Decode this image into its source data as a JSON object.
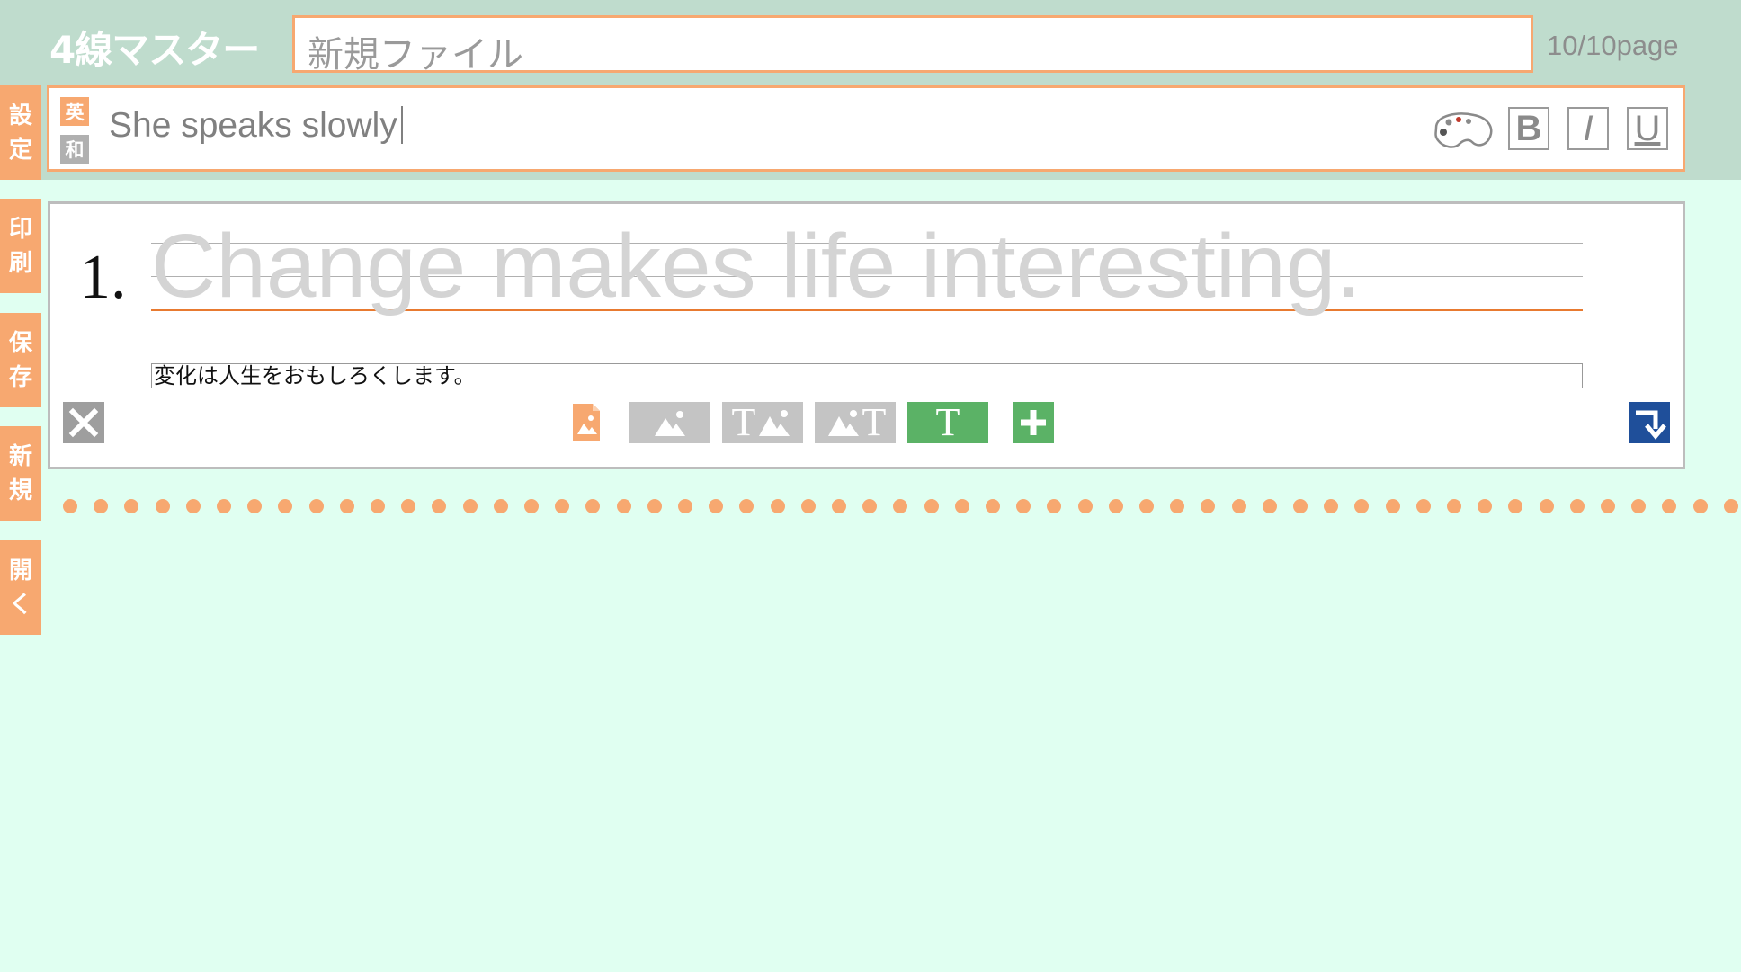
{
  "app": {
    "title": "4線マスター",
    "page_count": "10/10page"
  },
  "file": {
    "name": "新規ファイル"
  },
  "sidebar": {
    "items": [
      {
        "chars": [
          "設",
          "定"
        ]
      },
      {
        "chars": [
          "印",
          "刷"
        ]
      },
      {
        "chars": [
          "保",
          "存"
        ]
      },
      {
        "chars": [
          "新",
          "規"
        ]
      },
      {
        "chars": [
          "開",
          "く"
        ]
      }
    ]
  },
  "editor": {
    "lang_en": "英",
    "lang_ja": "和",
    "text": "She speaks slowly",
    "format": {
      "bold": "B",
      "italic": "I",
      "underline": "U"
    }
  },
  "card": {
    "number": "1.",
    "english": "Change makes life interesting.",
    "japanese": "変化は人生をおもしろくします。",
    "toolbar_t": "T"
  },
  "colors": {
    "accent": "#f7a870",
    "header": "#bfdccd",
    "background": "#e0fff1",
    "green": "#5bb266",
    "blue": "#1f4f9a"
  }
}
